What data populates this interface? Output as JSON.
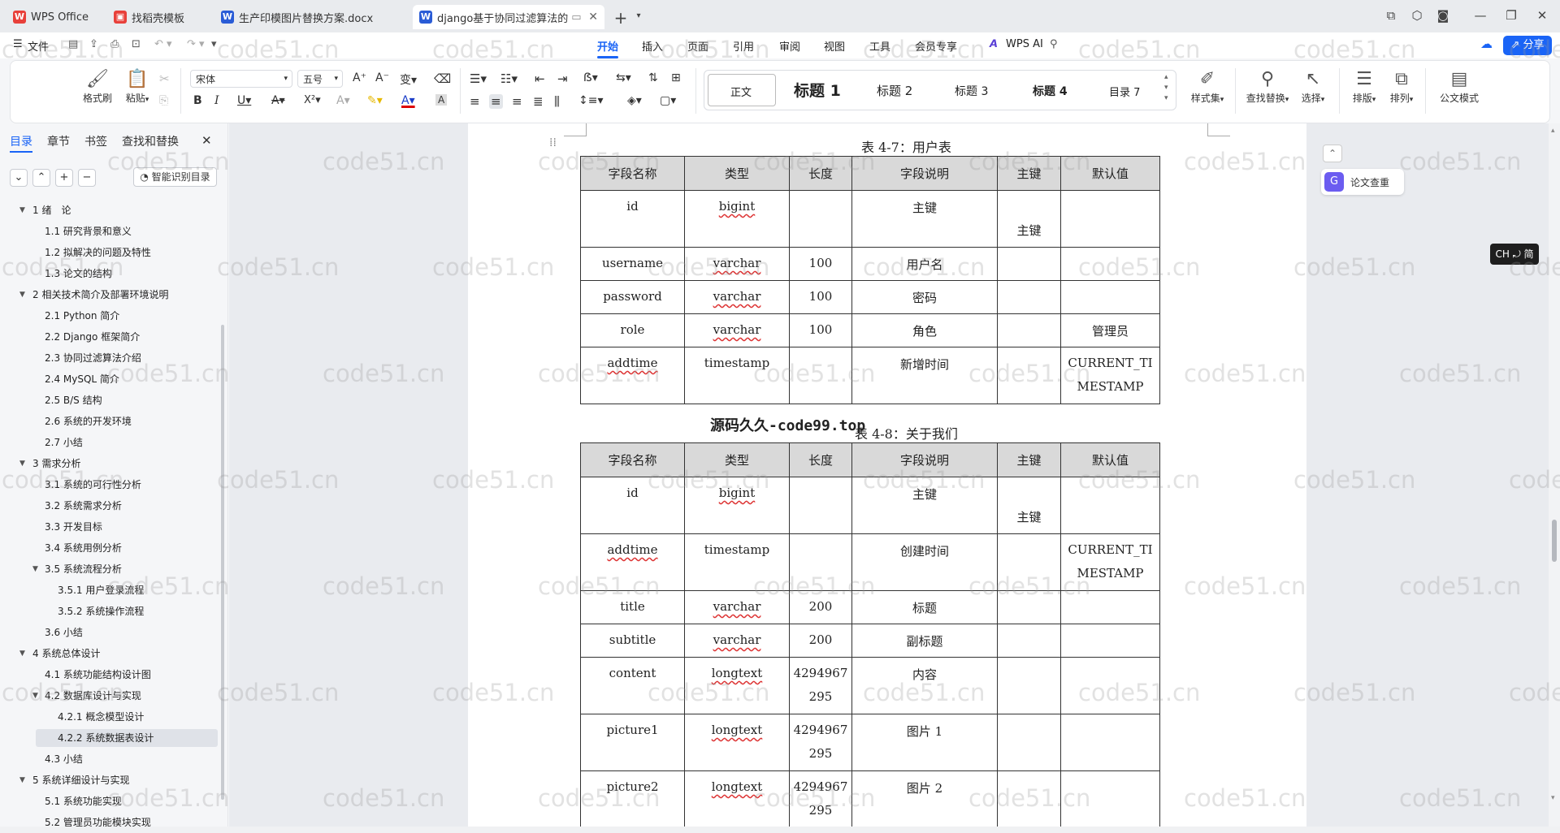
{
  "tabs": [
    {
      "label": "WPS Office",
      "icon": "W",
      "color": "#e8403a"
    },
    {
      "label": "找稻壳模板",
      "icon": "稻",
      "color": "#e8403a"
    },
    {
      "label": "生产印模图片替换方案.docx",
      "icon": "W",
      "color": "#2a5cd6"
    },
    {
      "label": "django基于协同过滤算法的",
      "icon": "W",
      "color": "#2a5cd6"
    }
  ],
  "menu": {
    "file": "文件",
    "items": [
      "开始",
      "插入",
      "页面",
      "引用",
      "审阅",
      "视图",
      "工具",
      "会员专享"
    ],
    "ai": "WPS AI",
    "share": "分享"
  },
  "toolbar": {
    "format_painter": "格式刷",
    "paste": "粘贴",
    "font": "宋体",
    "size": "五号",
    "styles": [
      "正文",
      "标题 1",
      "标题 2",
      "标题 3",
      "标题 4",
      "目录 7"
    ],
    "style_set": "样式集",
    "find_replace": "查找替换",
    "select": "选择",
    "layout": "排版",
    "arrange": "排列",
    "official": "公文模式"
  },
  "sidebar": {
    "tabs": [
      "目录",
      "章节",
      "书签",
      "查找和替换"
    ],
    "smart": "智能识别目录",
    "toc": [
      {
        "label": "1 绪　论",
        "level": 1,
        "expanded": true
      },
      {
        "label": "1.1 研究背景和意义",
        "level": 2
      },
      {
        "label": "1.2 拟解决的问题及特性",
        "level": 2
      },
      {
        "label": "1.3 论文的结构",
        "level": 2
      },
      {
        "label": "2 相关技术简介及部署环境说明",
        "level": 1,
        "expanded": true
      },
      {
        "label": "2.1 Python 简介",
        "level": 2
      },
      {
        "label": "2.2 Django 框架简介",
        "level": 2
      },
      {
        "label": "2.3  协同过滤算法介绍",
        "level": 2
      },
      {
        "label": "2.4 MySQL 简介",
        "level": 2
      },
      {
        "label": "2.5 B/S 结构",
        "level": 2
      },
      {
        "label": "2.6 系统的开发环境",
        "level": 2
      },
      {
        "label": "2.7 小结",
        "level": 2
      },
      {
        "label": "3 需求分析",
        "level": 1,
        "expanded": true
      },
      {
        "label": "3.1 系统的可行性分析",
        "level": 2
      },
      {
        "label": "3.2 系统需求分析",
        "level": 2
      },
      {
        "label": "3.3 开发目标",
        "level": 2
      },
      {
        "label": "3.4  系统用例分析",
        "level": 2
      },
      {
        "label": "3.5 系统流程分析",
        "level": 2,
        "expanded": true
      },
      {
        "label": "3.5.1  用户登录流程",
        "level": 3
      },
      {
        "label": "3.5.2  系统操作流程",
        "level": 3
      },
      {
        "label": "3.6 小结",
        "level": 2
      },
      {
        "label": "4  系统总体设计",
        "level": 1,
        "expanded": true
      },
      {
        "label": "4.1 系统功能结构设计图",
        "level": 2
      },
      {
        "label": "4.2  数据库设计与实现",
        "level": 2,
        "expanded": true
      },
      {
        "label": "4.2.1  概念模型设计",
        "level": 3
      },
      {
        "label": "4.2.2  系统数据表设计",
        "level": 3,
        "selected": true
      },
      {
        "label": "4.3 小结",
        "level": 2
      },
      {
        "label": "5  系统详细设计与实现",
        "level": 1,
        "expanded": true
      },
      {
        "label": "5.1 系统功能实现",
        "level": 2
      },
      {
        "label": "5.2 管理员功能模块实现",
        "level": 2
      }
    ]
  },
  "doc": {
    "headers": [
      "字段名称",
      "类型",
      "长度",
      "字段说明",
      "主键",
      "默认值"
    ],
    "table1": {
      "caption": "表 4-7：用户表",
      "rows": [
        [
          "id",
          "bigint",
          "",
          "主键",
          "主键",
          ""
        ],
        [
          "username",
          "varchar",
          "100",
          "用户名",
          "",
          ""
        ],
        [
          "password",
          "varchar",
          "100",
          "密码",
          "",
          ""
        ],
        [
          "role",
          "varchar",
          "100",
          "角色",
          "",
          "管理员"
        ],
        [
          "addtime",
          "timestamp",
          "",
          "新增时间",
          "",
          "CURRENT_TIMESTAMP"
        ]
      ]
    },
    "table2": {
      "caption": "表 4-8：关于我们",
      "overlay": "源码久久-code99.top",
      "rows": [
        [
          "id",
          "bigint",
          "",
          "主键",
          "主键",
          ""
        ],
        [
          "addtime",
          "timestamp",
          "",
          "创建时间",
          "",
          "CURRENT_TIMESTAMP"
        ],
        [
          "title",
          "varchar",
          "200",
          "标题",
          "",
          ""
        ],
        [
          "subtitle",
          "varchar",
          "200",
          "副标题",
          "",
          ""
        ],
        [
          "content",
          "longtext",
          "4294967295",
          "内容",
          "",
          ""
        ],
        [
          "picture1",
          "longtext",
          "4294967295",
          "图片 1",
          "",
          ""
        ],
        [
          "picture2",
          "longtext",
          "4294967295",
          "图片 2",
          "",
          ""
        ]
      ]
    }
  },
  "right_panel": {
    "check": "论文查重",
    "ime": "CH ⤾ 简"
  },
  "watermark": "code51.cn"
}
